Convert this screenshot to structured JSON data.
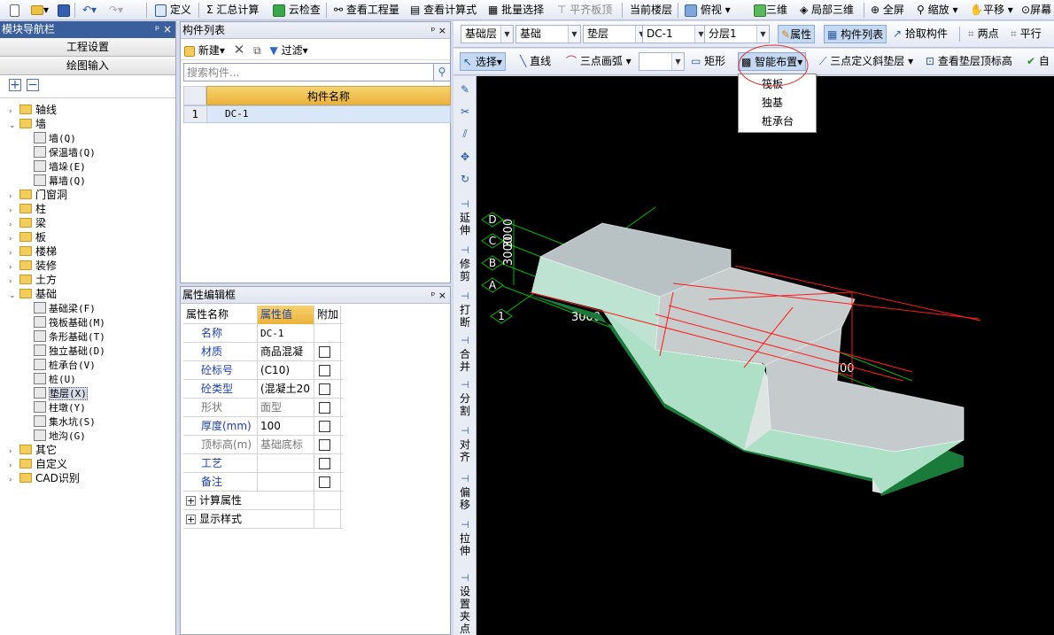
{
  "top_toolbar": {
    "items": [
      "定义",
      "汇总计算",
      "云检查",
      "查看工程量",
      "查看计算式",
      "批量选择",
      "平齐板顶",
      "当前楼层",
      "俯视",
      "三维",
      "局部三维",
      "全屏",
      "缩放",
      "平移",
      "屏幕"
    ]
  },
  "nav": {
    "title": "模块导航栏",
    "pin": "ᵖ ×",
    "btn_project": "工程设置",
    "btn_draw": "绘图输入",
    "tree": [
      {
        "label": "轴线",
        "level": 0,
        "expanded": false
      },
      {
        "label": "墙",
        "level": 0,
        "expanded": true
      },
      {
        "label": "墙(Q)",
        "level": 1
      },
      {
        "label": "保温墙(Q)",
        "level": 1
      },
      {
        "label": "墙垛(E)",
        "level": 1
      },
      {
        "label": "幕墙(Q)",
        "level": 1
      },
      {
        "label": "门窗洞",
        "level": 0,
        "expanded": false
      },
      {
        "label": "柱",
        "level": 0,
        "expanded": false
      },
      {
        "label": "梁",
        "level": 0,
        "expanded": false
      },
      {
        "label": "板",
        "level": 0,
        "expanded": false
      },
      {
        "label": "楼梯",
        "level": 0,
        "expanded": false
      },
      {
        "label": "装修",
        "level": 0,
        "expanded": false
      },
      {
        "label": "土方",
        "level": 0,
        "expanded": false
      },
      {
        "label": "基础",
        "level": 0,
        "expanded": true
      },
      {
        "label": "基础梁(F)",
        "level": 1
      },
      {
        "label": "筏板基础(M)",
        "level": 1
      },
      {
        "label": "条形基础(T)",
        "level": 1
      },
      {
        "label": "独立基础(D)",
        "level": 1
      },
      {
        "label": "桩承台(V)",
        "level": 1
      },
      {
        "label": "桩(U)",
        "level": 1
      },
      {
        "label": "垫层(X)",
        "level": 1,
        "selected": true
      },
      {
        "label": "柱墩(Y)",
        "level": 1
      },
      {
        "label": "集水坑(S)",
        "level": 1
      },
      {
        "label": "地沟(G)",
        "level": 1
      },
      {
        "label": "其它",
        "level": 0,
        "expanded": false
      },
      {
        "label": "自定义",
        "level": 0,
        "expanded": false
      },
      {
        "label": "CAD识别",
        "level": 0,
        "expanded": false
      }
    ]
  },
  "complist": {
    "title": "构件列表",
    "ctl": "ᵖ ×",
    "new_label": "新建",
    "filter_label": "过滤",
    "search_placeholder": "搜索构件...",
    "header": "构件名称",
    "rows": [
      {
        "num": "1",
        "name": "DC-1"
      }
    ]
  },
  "props": {
    "title": "属性编辑框",
    "ctl": "ᵖ ×",
    "headers": [
      "属性名称",
      "属性值",
      "附加"
    ],
    "rows": [
      {
        "name": "名称",
        "value": "DC-1",
        "blue": true,
        "cb": false
      },
      {
        "name": "材质",
        "value": "商品混凝",
        "blue": true,
        "cb": true
      },
      {
        "name": "砼标号",
        "value": "(C10)",
        "blue": true,
        "cb": true
      },
      {
        "name": "砼类型",
        "value": "(混凝土20",
        "blue": true,
        "cb": true
      },
      {
        "name": "形状",
        "value": "面型",
        "blue": false,
        "cb": true
      },
      {
        "name": "厚度(mm)",
        "value": "100",
        "blue": true,
        "cb": true
      },
      {
        "name": "顶标高(m)",
        "value": "基础底标",
        "blue": false,
        "cb": true
      },
      {
        "name": "工艺",
        "value": "",
        "blue": true,
        "cb": true
      },
      {
        "name": "备注",
        "value": "",
        "blue": true,
        "cb": true
      },
      {
        "name": "计算属性",
        "value": "",
        "group": true
      },
      {
        "name": "显示样式",
        "value": "",
        "group": true
      }
    ]
  },
  "row1": {
    "floor": "基础层",
    "type": "基础",
    "comp": "垫层",
    "name": "DC-1",
    "layer": "分层1",
    "btn_attr": "属性",
    "btn_list": "构件列表",
    "btn_pick": "拾取构件",
    "btn_two": "两点",
    "btn_par": "平行"
  },
  "row2": {
    "select": "选择",
    "line": "直线",
    "arc": "三点画弧",
    "rect": "矩形",
    "smart": "智能布置",
    "slope": "三点定义斜垫层",
    "check": "查看垫层顶标高",
    "auto": "自"
  },
  "dropdown": {
    "items": [
      "筏板",
      "独基",
      "桩承台"
    ]
  },
  "vtools": [
    "延伸",
    "修剪",
    "打断",
    "合并",
    "分割",
    "对齐",
    "偏移",
    "拉伸",
    "设置夹点"
  ],
  "canvas": {
    "axes": [
      "D",
      "C",
      "B",
      "A",
      "1"
    ],
    "dims": [
      "3000",
      "3000",
      "3000",
      "00"
    ]
  },
  "colors": {
    "accent": "#3a5f9c",
    "header_gold": "#ebb23b",
    "select_blue": "#d9e7f8",
    "green": "#00cc00",
    "red": "#ff0000"
  }
}
